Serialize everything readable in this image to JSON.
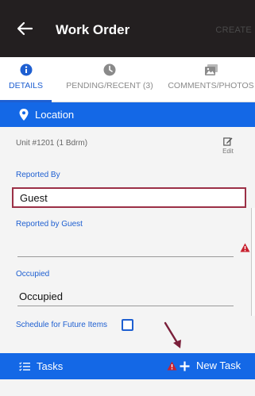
{
  "header": {
    "title": "Work Order",
    "create_label": "CREATE",
    "back_icon": "arrow-left-icon"
  },
  "tabs": [
    {
      "label": "DETAILS",
      "icon": "info-circle-icon",
      "active": true
    },
    {
      "label": "PENDING/RECENT (3)",
      "icon": "clock-icon",
      "active": false
    },
    {
      "label": "COMMENTS/PHOTOS",
      "icon": "photos-icon",
      "active": false
    }
  ],
  "location": {
    "label": "Location",
    "icon": "map-pin-icon"
  },
  "unit": {
    "text": "Unit #1201 (1 Bdrm)",
    "edit_label": "Edit"
  },
  "fields": {
    "reported_by": {
      "label": "Reported By",
      "value": "Guest"
    },
    "reported_by_guest": {
      "label": "Reported by Guest",
      "value": ""
    },
    "occupied": {
      "label": "Occupied",
      "value": "Occupied"
    },
    "schedule": {
      "label": "Schedule for Future Items",
      "checked": false
    }
  },
  "tasks": {
    "label": "Tasks",
    "new_task_label": "New Task",
    "icon": "list-icon"
  },
  "colors": {
    "header_bg": "#231f20",
    "accent": "#1468e6",
    "highlight_border": "#9b3046",
    "warning": "#c8202e"
  }
}
